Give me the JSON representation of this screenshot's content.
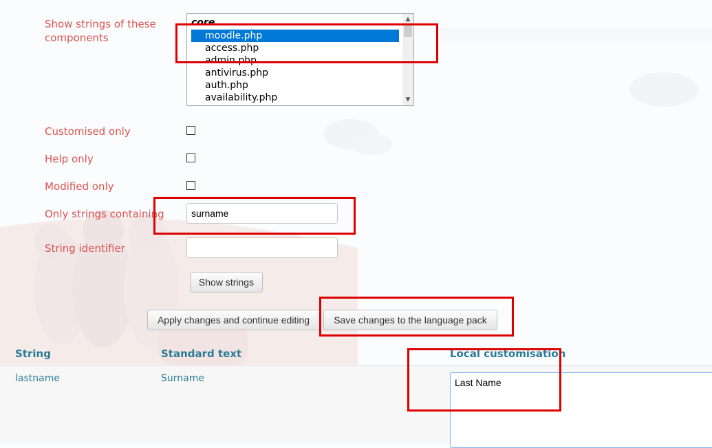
{
  "form": {
    "components_label": "Show strings of these components",
    "components_list": {
      "group_label": "core",
      "options": [
        "moodle.php",
        "access.php",
        "admin.php",
        "antivirus.php",
        "auth.php",
        "availability.php"
      ],
      "selected": "moodle.php"
    },
    "customised_only_label": "Customised only",
    "help_only_label": "Help only",
    "modified_only_label": "Modified only",
    "only_strings_containing_label": "Only strings containing",
    "only_strings_containing_value": "surname",
    "string_identifier_label": "String identifier",
    "string_identifier_value": "",
    "show_strings_button": "Show strings",
    "apply_changes_button": "Apply changes and continue editing",
    "save_changes_button": "Save changes to the language pack"
  },
  "table": {
    "headers": [
      "String",
      "Standard text",
      "Local customisation"
    ],
    "rows": [
      {
        "string": "lastname",
        "standard": "Surname",
        "local": "Last Name"
      }
    ]
  },
  "annotation_color": "#dd0000",
  "label_color": "#d9534f",
  "link_color": "#2a7b96"
}
